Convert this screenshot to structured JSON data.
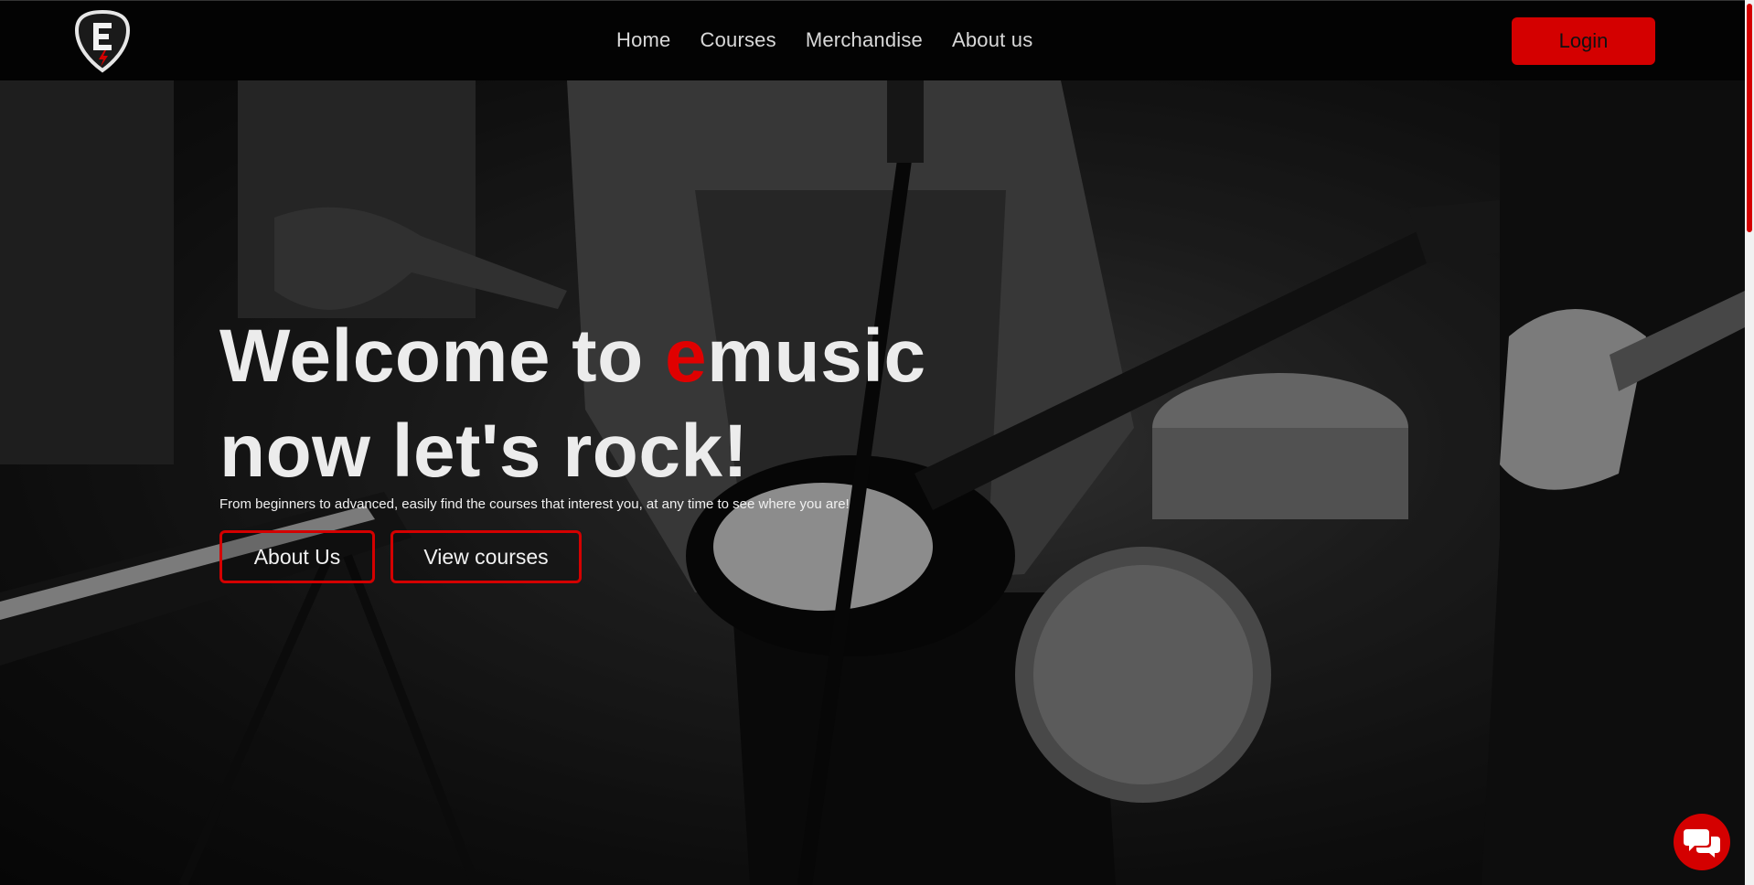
{
  "brand": {
    "logo_icon": "guitar-pick-e-logo",
    "accent_color": "#d40000"
  },
  "nav": {
    "items": [
      {
        "label": "Home"
      },
      {
        "label": "Courses"
      },
      {
        "label": "Merchandise"
      },
      {
        "label": "About us"
      }
    ],
    "login_label": "Login"
  },
  "hero": {
    "title_line1_prefix": "Welcome to ",
    "title_accent": "e",
    "title_line1_suffix": "music",
    "title_line2": "now let's rock!",
    "subtitle": "From beginners to advanced, easily find the courses that interest you, at any time to see where you are!",
    "buttons": {
      "about": "About Us",
      "courses": "View courses"
    },
    "background_image": "black-and-white-rock-band-performing"
  },
  "chat": {
    "icon": "chat-bubbles-icon"
  }
}
